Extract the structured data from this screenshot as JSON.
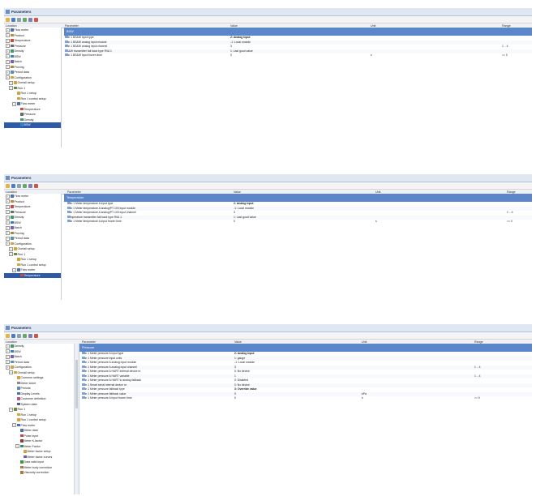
{
  "panels": [
    {
      "title": "Parameters",
      "columns": {
        "location": "Location",
        "parameter": "Parameter",
        "value": "Value",
        "unit": "Unit",
        "range": "Range"
      },
      "tree": [
        {
          "label": "Flow meter",
          "depth": 0,
          "icon": "flow-meter-icon"
        },
        {
          "label": "Product",
          "depth": 0,
          "icon": "product-icon"
        },
        {
          "label": "Temperature",
          "depth": 0,
          "icon": "thermometer-icon"
        },
        {
          "label": "Pressure",
          "depth": 0,
          "icon": "gauge-icon"
        },
        {
          "label": "Density",
          "depth": 0,
          "icon": "density-icon"
        },
        {
          "label": "BSW",
          "depth": 0,
          "icon": "bsw-icon"
        },
        {
          "label": "Batch",
          "depth": 0,
          "icon": "batch-icon"
        },
        {
          "label": "Proving",
          "depth": 0,
          "icon": "proving-icon"
        },
        {
          "label": "Period data",
          "depth": 0,
          "icon": "period-icon"
        },
        {
          "label": "Configuration",
          "depth": 0,
          "icon": "wrench-icon"
        },
        {
          "label": "Overall setup",
          "depth": 1,
          "icon": "wrench-icon"
        },
        {
          "label": "Run 1",
          "depth": 1,
          "icon": "run-icon"
        },
        {
          "label": "Run 1 setup",
          "depth": 2,
          "icon": "wrench-icon"
        },
        {
          "label": "Run 1 control setup",
          "depth": 2,
          "icon": "wrench-icon"
        },
        {
          "label": "Flow meter",
          "depth": 2,
          "icon": "flow-meter-icon"
        },
        {
          "label": "Temperature",
          "depth": 3,
          "icon": "thermometer-icon"
        },
        {
          "label": "Pressure",
          "depth": 3,
          "icon": "gauge-icon"
        },
        {
          "label": "Density",
          "depth": 3,
          "icon": "density-icon"
        },
        {
          "label": "BSW",
          "depth": 3,
          "icon": "bsw-icon",
          "selected": true
        }
      ],
      "group": "BSW",
      "rows": [
        {
          "parameter": "Run 1 BS&W input type",
          "value": "2: Analog input",
          "unit": "",
          "range": ""
        },
        {
          "parameter": "Run 1 BS&W analog input module",
          "value": "-1: Local module",
          "unit": "",
          "range": ""
        },
        {
          "parameter": "Run 1 BS&W analog input channel",
          "value": "3",
          "unit": "",
          "range": "1 .. 4"
        },
        {
          "parameter": "BS&W transmitter fail back type RVA 1",
          "value": "1: Last good value",
          "unit": "",
          "range": ""
        },
        {
          "parameter": "Run 1 BS&W input frozen time",
          "value": "0",
          "unit": "s",
          "range": ">= 0"
        }
      ]
    },
    {
      "title": "Parameters",
      "columns": {
        "location": "Location",
        "parameter": "Parameter",
        "value": "Value",
        "unit": "Unit",
        "range": "Range"
      },
      "tree": [
        {
          "label": "Flow meter",
          "depth": 0,
          "icon": "flow-meter-icon"
        },
        {
          "label": "Product",
          "depth": 0,
          "icon": "product-icon"
        },
        {
          "label": "Temperature",
          "depth": 0,
          "icon": "thermometer-icon"
        },
        {
          "label": "Pressure",
          "depth": 0,
          "icon": "gauge-icon"
        },
        {
          "label": "Density",
          "depth": 0,
          "icon": "density-icon"
        },
        {
          "label": "BSW",
          "depth": 0,
          "icon": "bsw-icon"
        },
        {
          "label": "Batch",
          "depth": 0,
          "icon": "batch-icon"
        },
        {
          "label": "Proving",
          "depth": 0,
          "icon": "proving-icon"
        },
        {
          "label": "Period data",
          "depth": 0,
          "icon": "period-icon"
        },
        {
          "label": "Configuration",
          "depth": 0,
          "icon": "wrench-icon"
        },
        {
          "label": "Overall setup",
          "depth": 1,
          "icon": "wrench-icon"
        },
        {
          "label": "Run 1",
          "depth": 1,
          "icon": "run-icon"
        },
        {
          "label": "Run 1 setup",
          "depth": 2,
          "icon": "wrench-icon"
        },
        {
          "label": "Run 1 control setup",
          "depth": 2,
          "icon": "wrench-icon"
        },
        {
          "label": "Flow meter",
          "depth": 2,
          "icon": "flow-meter-icon"
        },
        {
          "label": "Temperature",
          "depth": 3,
          "icon": "thermometer-icon",
          "selected": true
        }
      ],
      "group": "Temperature",
      "rows": [
        {
          "parameter": "Run 1 Meter temperature A input type",
          "value": "2: Analog input",
          "unit": "",
          "range": ""
        },
        {
          "parameter": "Run 1 Meter temperature A analog/PT-100 input module",
          "value": "-1: Local module",
          "unit": "",
          "range": ""
        },
        {
          "parameter": "Run 1 Meter temperature A analog/PT-100 input channel",
          "value": "3",
          "unit": "",
          "range": "1 .. 4"
        },
        {
          "parameter": "Temperature transmitter fall back type RVA 1",
          "value": "1: Last good value",
          "unit": "",
          "range": ""
        },
        {
          "parameter": "Run 1 Meter temperature A input frozen time",
          "value": "0",
          "unit": "s",
          "range": ">= 0"
        }
      ]
    },
    {
      "title": "Parameters",
      "columns": {
        "location": "Location",
        "parameter": "Parameter",
        "value": "Value",
        "unit": "Unit",
        "range": "Range"
      },
      "tree": [
        {
          "label": "Density",
          "depth": 0,
          "icon": "density-icon"
        },
        {
          "label": "BSW",
          "depth": 0,
          "icon": "bsw-icon"
        },
        {
          "label": "Batch",
          "depth": 0,
          "icon": "batch-icon"
        },
        {
          "label": "Period data",
          "depth": 0,
          "icon": "period-icon"
        },
        {
          "label": "Configuration",
          "depth": 0,
          "icon": "wrench-icon"
        },
        {
          "label": "Overall setup",
          "depth": 1,
          "icon": "wrench-icon"
        },
        {
          "label": "Common settings",
          "depth": 2,
          "icon": "wrench-icon"
        },
        {
          "label": "Meter ticket",
          "depth": 2,
          "icon": "ticket-icon"
        },
        {
          "label": "Periods",
          "depth": 2,
          "icon": "period-icon"
        },
        {
          "label": "Display Levels",
          "depth": 2,
          "icon": "display-icon"
        },
        {
          "label": "Customer definition",
          "depth": 2,
          "icon": "customer-icon"
        },
        {
          "label": "System data",
          "depth": 2,
          "icon": "system-icon"
        },
        {
          "label": "Run 1",
          "depth": 1,
          "icon": "run-icon"
        },
        {
          "label": "Run 1 setup",
          "depth": 2,
          "icon": "wrench-icon"
        },
        {
          "label": "Run 1 control setup",
          "depth": 2,
          "icon": "wrench-icon"
        },
        {
          "label": "Flow meter",
          "depth": 2,
          "icon": "flow-meter-icon"
        },
        {
          "label": "Meter data",
          "depth": 3,
          "icon": "data-icon"
        },
        {
          "label": "Pulse input",
          "depth": 3,
          "icon": "pulse-icon"
        },
        {
          "label": "Meter K-factor",
          "depth": 3,
          "icon": "k-factor-icon"
        },
        {
          "label": "Meter Factor",
          "depth": 3,
          "icon": "factor-icon"
        },
        {
          "label": "Meter factor setup",
          "depth": 4,
          "icon": "wrench-icon"
        },
        {
          "label": "Meter factor curves",
          "depth": 4,
          "icon": "curve-icon"
        },
        {
          "label": "Data valid input",
          "depth": 3,
          "icon": "valid-icon"
        },
        {
          "label": "Meter body correction",
          "depth": 3,
          "icon": "correction-icon"
        },
        {
          "label": "Viscosity correction",
          "depth": 3,
          "icon": "correction-icon"
        }
      ],
      "group": "Pressure",
      "rows": [
        {
          "parameter": "Run 1 Meter pressure A input type",
          "value": "2: Analog input",
          "unit": "",
          "range": ""
        },
        {
          "parameter": "Run 1 Meter pressure input units",
          "value": "1: gauge",
          "unit": "",
          "range": ""
        },
        {
          "parameter": "Run 1 Meter pressure A analog input module",
          "value": "-1: Local module",
          "unit": "",
          "range": ""
        },
        {
          "parameter": "Run 1 Meter pressure A analog input channel",
          "value": "3",
          "unit": "",
          "range": "1 .. 4"
        },
        {
          "parameter": "Run 1 Meter pressure A HART internal device nr.",
          "value": "0: No device",
          "unit": "",
          "range": ""
        },
        {
          "parameter": "Run 1 Meter pressure A HART variable",
          "value": "1",
          "unit": "",
          "range": "1 .. 4"
        },
        {
          "parameter": "Run 1 Meter pressure A HART to analog fallback",
          "value": "0: Disabled",
          "unit": "",
          "range": ""
        },
        {
          "parameter": "Run 1 Smart serial internal device nr.",
          "value": "0: No device",
          "unit": "",
          "range": ""
        },
        {
          "parameter": "Run 1 Meter pressure fallback type",
          "value": "3: Override value",
          "unit": "",
          "range": ""
        },
        {
          "parameter": "Run 1 Meter pressure fallback value",
          "value": "0",
          "unit": "kPa",
          "range": ""
        },
        {
          "parameter": "Run 1 Meter pressure A input frozen time",
          "value": "0",
          "unit": "s",
          "range": ">= 0"
        }
      ]
    }
  ],
  "colors": {
    "accent": "#5b86c9",
    "selection": "#2e5aa8",
    "header": "#eef1f6"
  }
}
